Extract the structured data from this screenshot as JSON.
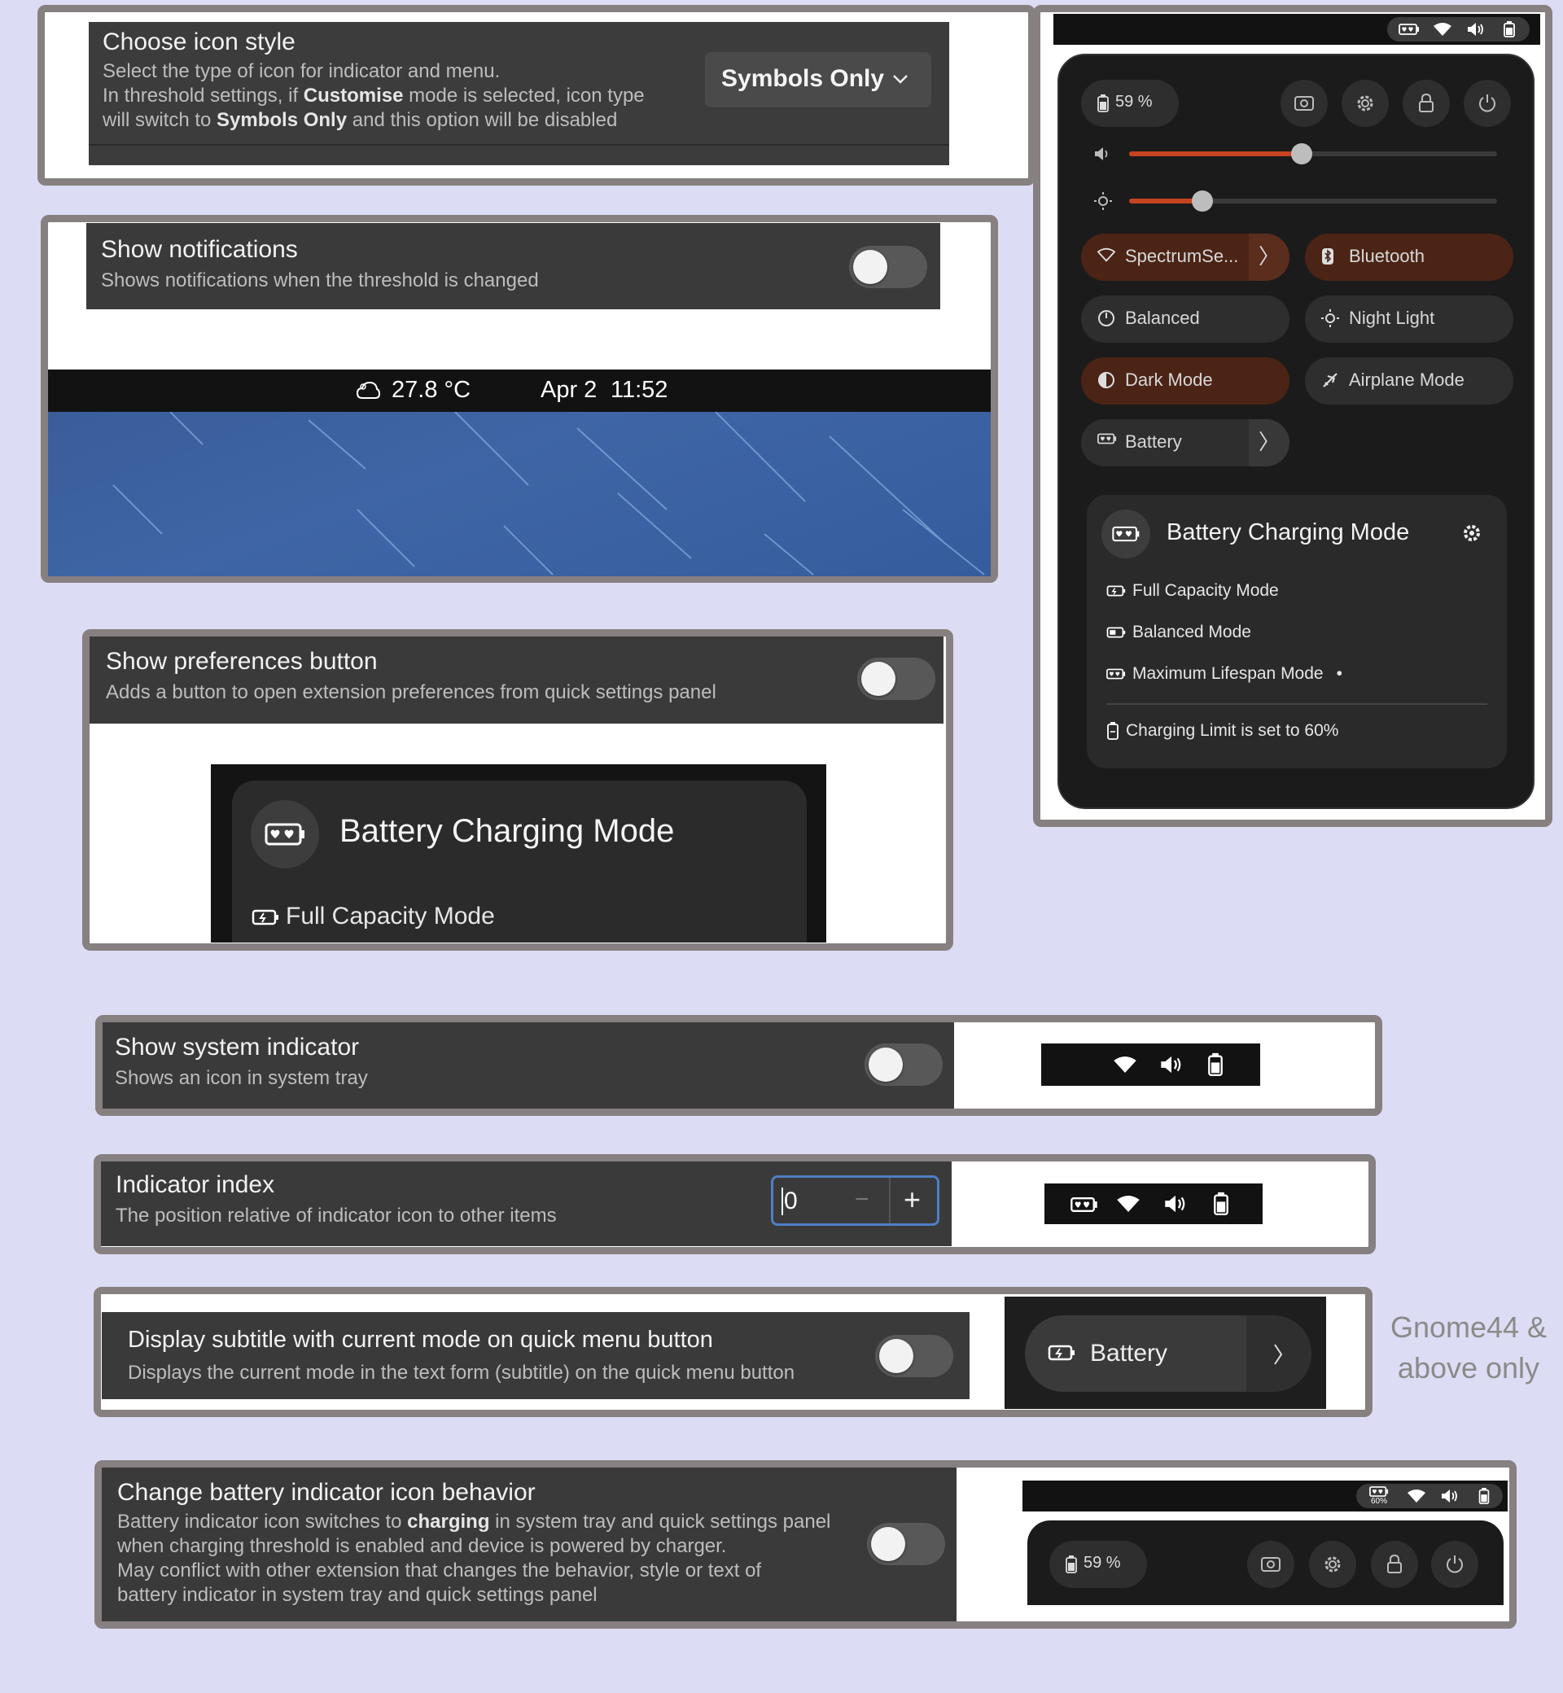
{
  "icon_style": {
    "title": "Choose icon style",
    "desc_line1": "Select the type of icon for indicator and menu.",
    "desc_line2_a": "In threshold settings, if ",
    "desc_line2_b": "Customise",
    "desc_line2_c": " mode is selected, icon type",
    "desc_line3_a": "will switch to ",
    "desc_line3_b": "Symbols Only",
    "desc_line3_c": " and this option will be disabled",
    "dropdown_value": "Symbols Only"
  },
  "notifications": {
    "title": "Show notifications",
    "desc": "Shows notifications when the threshold is changed",
    "toggle_on": false,
    "weather_temp": "27.8 °C",
    "clock_date": "Apr 2",
    "clock_time": "11:52"
  },
  "preferences": {
    "title": "Show preferences button",
    "desc": "Adds a button to open extension preferences from quick settings panel",
    "toggle_on": false,
    "preview_title": "Battery Charging Mode",
    "preview_item": "Full Capacity Mode"
  },
  "system_indicator": {
    "title": "Show system indicator",
    "desc": "Shows an icon in system tray",
    "toggle_on": false
  },
  "indicator_index": {
    "title": "Indicator index",
    "desc": "The position relative of indicator icon to other items",
    "value": "0",
    "minus": "−",
    "plus": "+"
  },
  "subtitle": {
    "title": "Display subtitle with current mode on quick menu button",
    "desc": "Displays the current mode in the text form (subtitle) on the quick menu button",
    "toggle_on": false,
    "preview_label": "Battery",
    "note_line1": "Gnome44 &",
    "note_line2": "above only"
  },
  "behavior": {
    "title": "Change battery indicator icon behavior",
    "line1_a": "Battery indicator icon switches to ",
    "line1_b": "charging",
    "line1_c": " in system tray and quick settings panel",
    "line2": "when charging threshold is enabled and device is powered by charger.",
    "line3": "May conflict with other extension that changes the behavior, style or text of",
    "line4": "battery indicator in system tray and quick settings panel",
    "toggle_on": false,
    "preview_battery": "59 %",
    "preview_badge": "60%"
  },
  "quick_settings": {
    "battery_percent": "59 %",
    "volume_level": 0.47,
    "brightness_level": 0.2,
    "tiles": [
      {
        "label": "SpectrumSe...",
        "active": true,
        "arrow": "〉"
      },
      {
        "label": "Bluetooth",
        "active": true
      },
      {
        "label": "Balanced",
        "active": false
      },
      {
        "label": "Night Light",
        "active": false
      },
      {
        "label": "Dark Mode",
        "active": true
      },
      {
        "label": "Airplane Mode",
        "active": false
      },
      {
        "label": "Battery",
        "active": false,
        "arrow": "〉"
      }
    ],
    "menu_title": "Battery Charging Mode",
    "modes": [
      "Full Capacity Mode",
      "Balanced Mode",
      "Maximum Lifespan Mode"
    ],
    "active_marker": "•",
    "limit_text": "Charging Limit is set to 60%"
  },
  "colors": {
    "page_bg": "#dcdcf4",
    "frame": "#878080",
    "row_bg": "#3a3a3a",
    "accent": "#c5431f",
    "active_tile": "#4b2416"
  }
}
